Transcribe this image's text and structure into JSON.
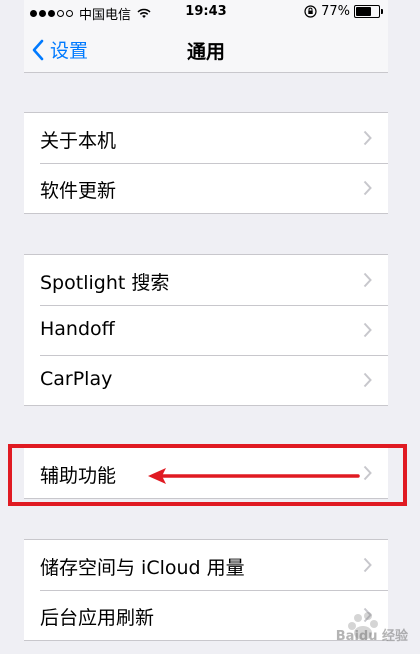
{
  "status_bar": {
    "carrier": "中国电信",
    "time": "19:43",
    "battery": "77%",
    "battery_level": 0.77
  },
  "nav": {
    "back_label": "设置",
    "title": "通用"
  },
  "groups": [
    {
      "items": [
        {
          "label": "关于本机"
        },
        {
          "label": "软件更新"
        }
      ]
    },
    {
      "items": [
        {
          "label": "Spotlight 搜索"
        },
        {
          "label": "Handoff"
        },
        {
          "label": "CarPlay"
        }
      ]
    },
    {
      "items": [
        {
          "label": "辅助功能"
        }
      ]
    },
    {
      "items": [
        {
          "label": "储存空间与 iCloud 用量"
        },
        {
          "label": "后台应用刷新"
        }
      ]
    }
  ],
  "annotation": {
    "color": "#e01a22"
  },
  "watermark": {
    "text": "Baidu 经验"
  },
  "colors": {
    "accent": "#007aff",
    "background": "#efeff4",
    "separator": "#c8c7cc"
  }
}
